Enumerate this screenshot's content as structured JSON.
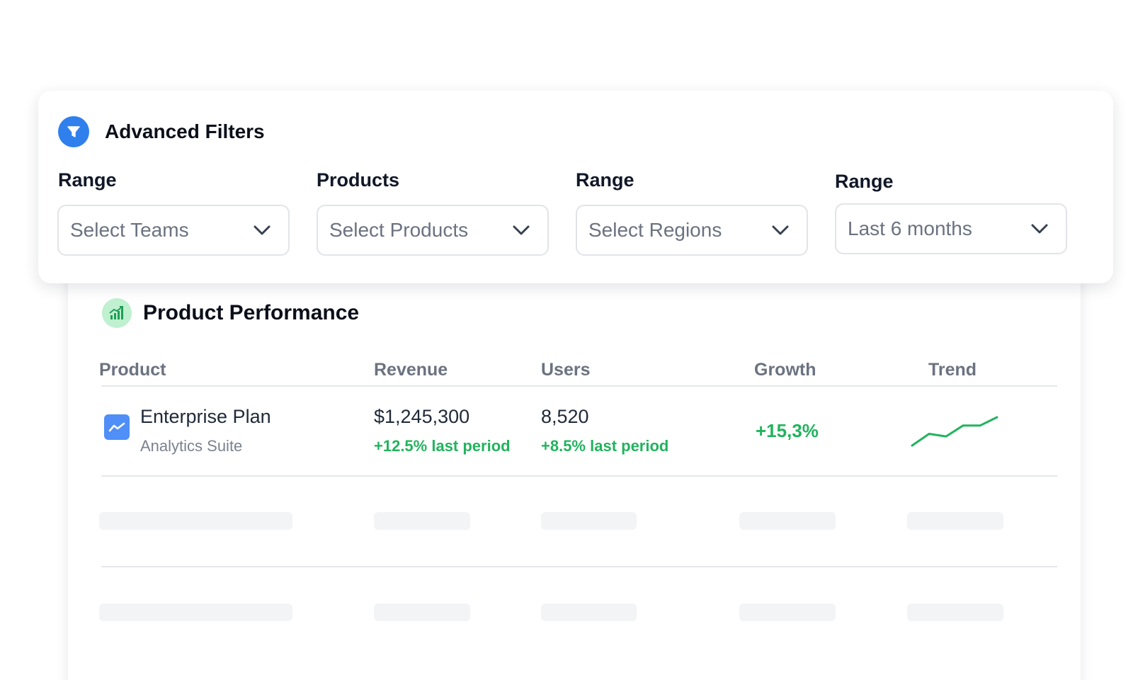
{
  "filters": {
    "title": "Advanced Filters",
    "icon": "filter-icon",
    "accent_color": "#2f80ed",
    "groups": [
      {
        "label": "Range",
        "value": "Select Teams"
      },
      {
        "label": "Products",
        "value": "Select Products"
      },
      {
        "label": "Range",
        "value": "Select Regions"
      },
      {
        "label": "Range",
        "value": "Last 6 months"
      }
    ]
  },
  "performance": {
    "title": "Product Performance",
    "icon": "bar-chart-icon",
    "columns": [
      "Product",
      "Revenue",
      "Users",
      "Growth",
      "Trend"
    ],
    "rows": [
      {
        "icon": "trend-line-icon",
        "product": "Enterprise Plan",
        "product_sub": "Analytics Suite",
        "revenue": "$1,245,300",
        "revenue_change": "+12.5% last period",
        "users": "8,520",
        "users_change": "+8.5% last period",
        "growth": "+15,3%",
        "trend": [
          2,
          16,
          13,
          26,
          26,
          36
        ]
      }
    ],
    "loading_rows": 2,
    "positive_color": "#22b35e"
  }
}
